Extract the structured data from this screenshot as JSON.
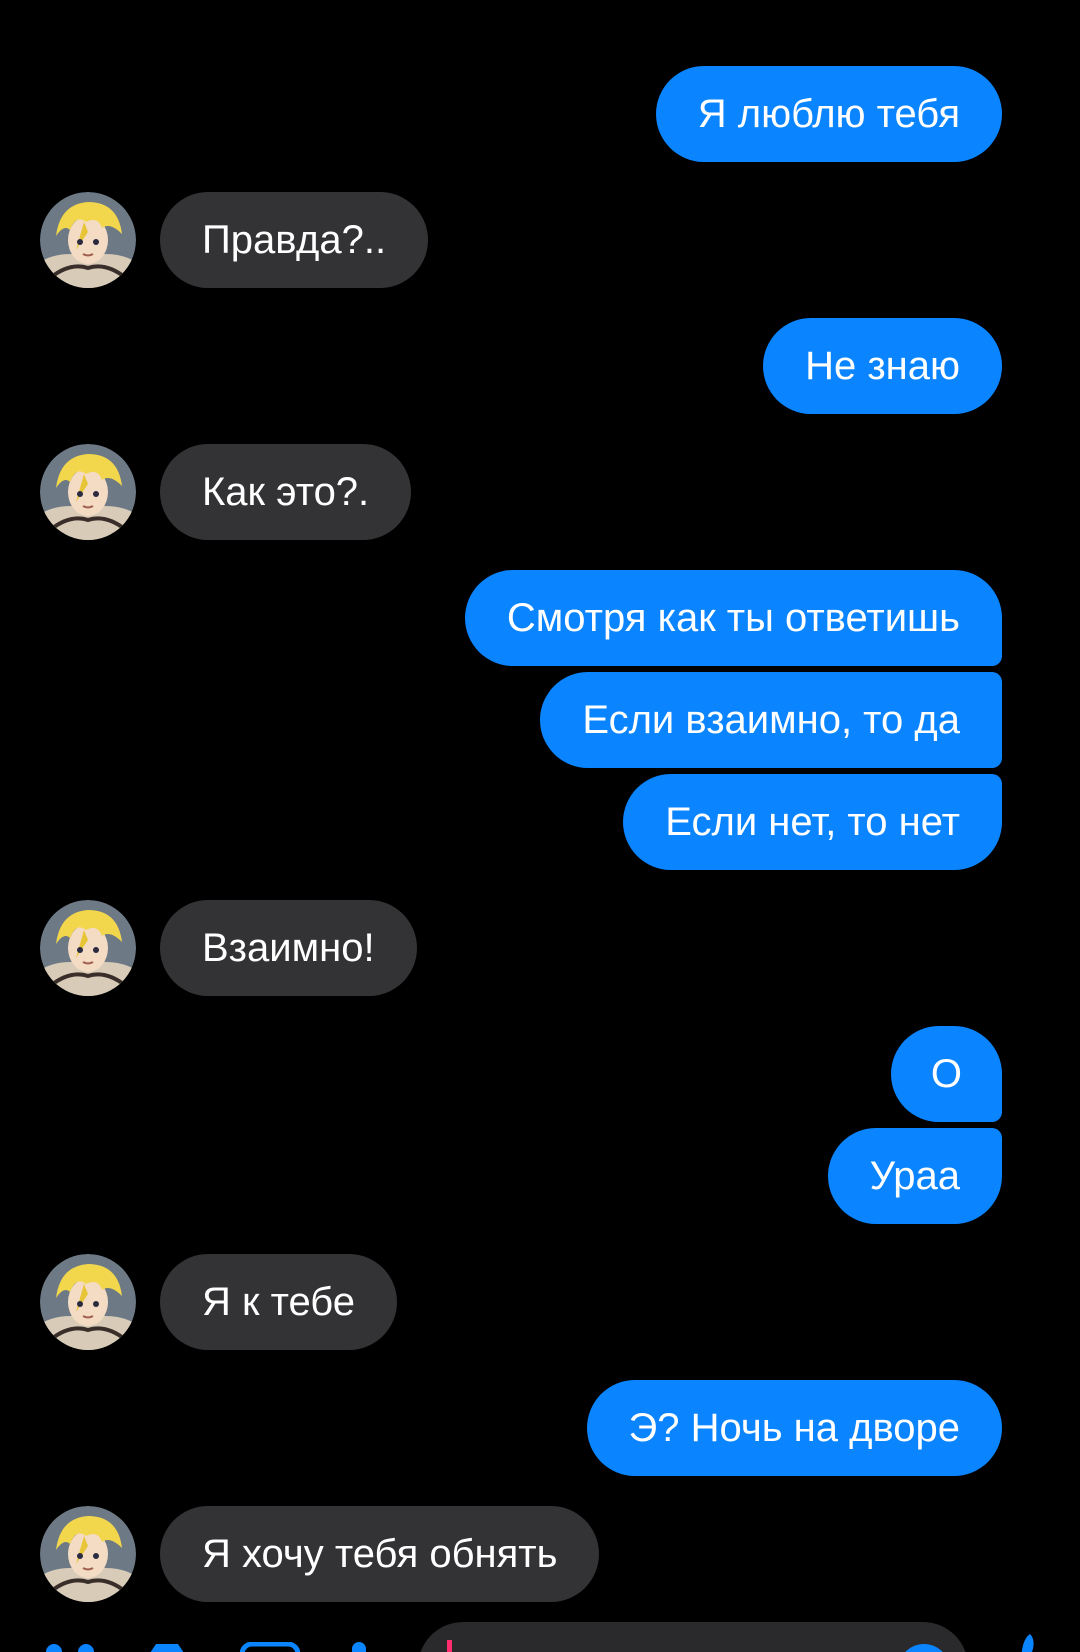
{
  "colors": {
    "background": "#000000",
    "outgoing_bubble": "#0a84ff",
    "incoming_bubble": "#333335",
    "text": "#ffffff",
    "accent": "#0a84ff",
    "caret": "#ff2d6f"
  },
  "messages": [
    {
      "direction": "out",
      "text": "Я люблю тебя"
    },
    {
      "direction": "in",
      "text": "Правда?.."
    },
    {
      "direction": "out",
      "text": "Не знаю"
    },
    {
      "direction": "in",
      "text": "Как это?."
    },
    {
      "direction": "out",
      "text": "Смотря как ты ответишь"
    },
    {
      "direction": "out",
      "text": "Если взаимно, то да"
    },
    {
      "direction": "out",
      "text": "Если нет, то нет"
    },
    {
      "direction": "in",
      "text": "Взаимно!"
    },
    {
      "direction": "out",
      "text": "О"
    },
    {
      "direction": "out",
      "text": "Ураа"
    },
    {
      "direction": "in",
      "text": "Я к тебе"
    },
    {
      "direction": "out",
      "text": "Э? Ночь на дворе"
    },
    {
      "direction": "in",
      "text": "Я хочу тебя обнять"
    }
  ],
  "contact": {
    "avatar_icon": "anime-avatar"
  },
  "composer": {
    "icons": [
      "apps-icon",
      "camera-icon",
      "image-icon",
      "microphone-icon",
      "emoji-icon",
      "like-icon"
    ],
    "value": ""
  }
}
